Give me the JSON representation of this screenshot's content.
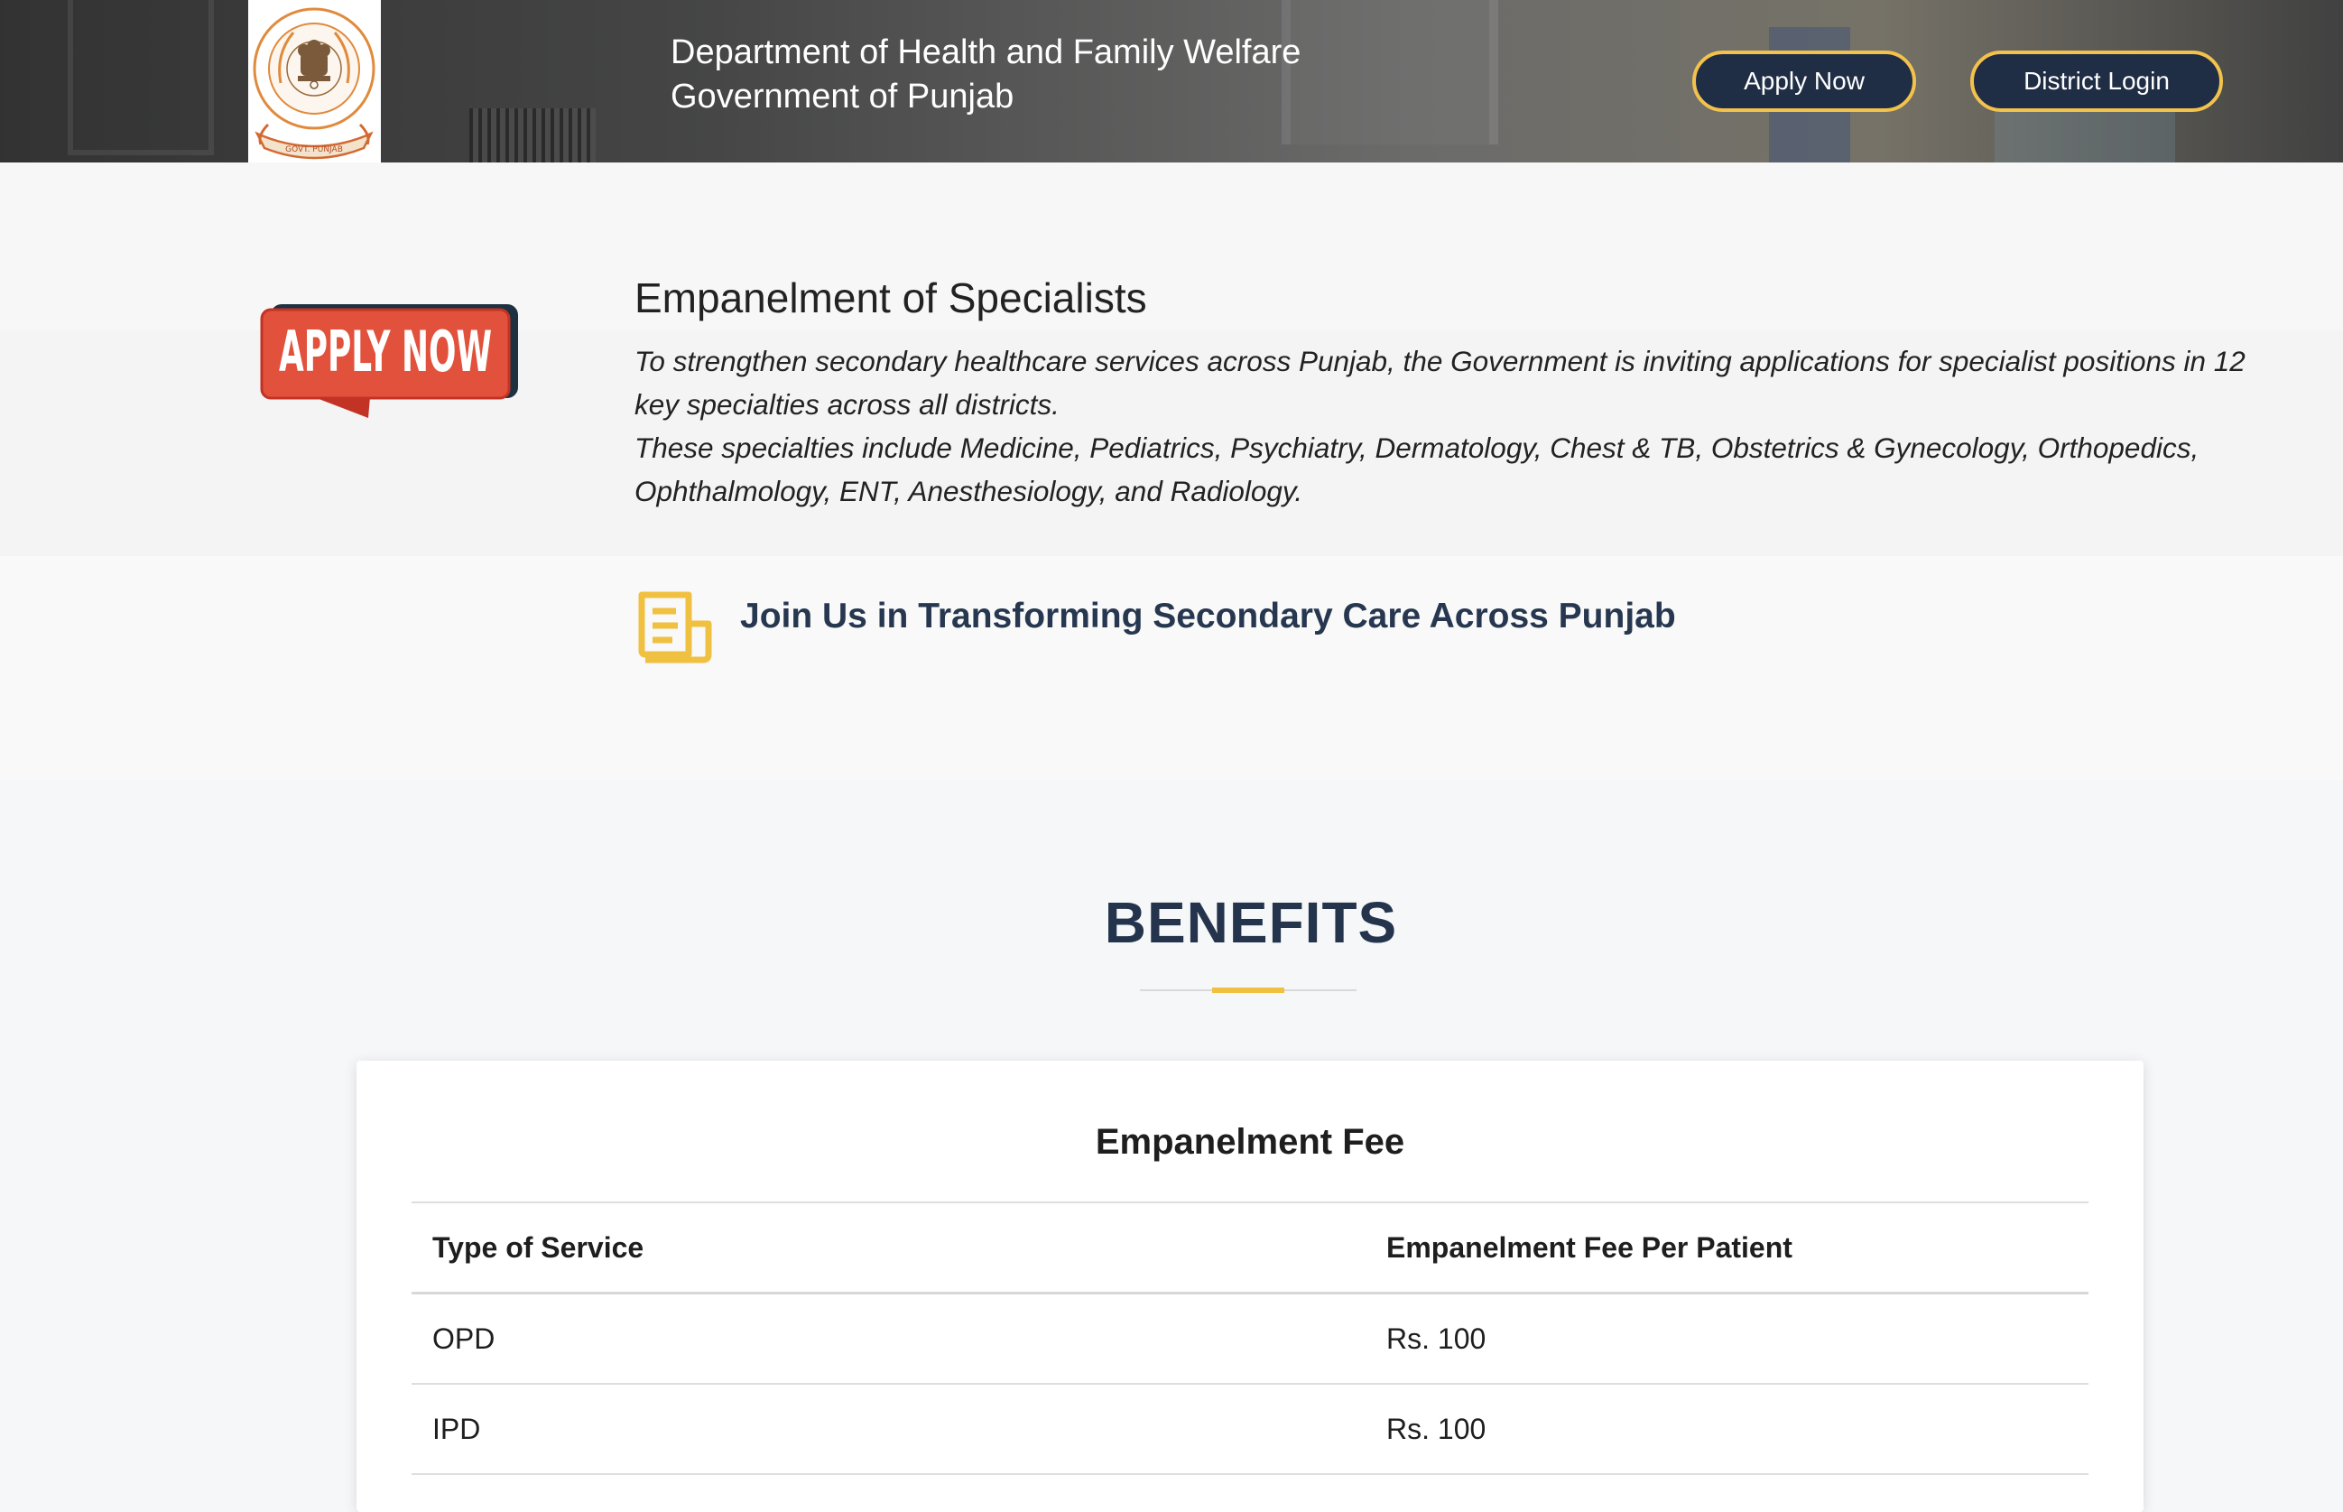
{
  "header": {
    "title_line1": "Department of Health and Family Welfare",
    "title_line2": "Government of Punjab",
    "emblem_icon": "punjab-govt-emblem",
    "emblem_caption": "GOVT. PUNJAB",
    "apply_button": "Apply Now",
    "district_login_button": "District Login",
    "button_bg": "#1f2d45",
    "button_border": "#f3c24c"
  },
  "intro": {
    "badge_text": "APPLY NOW",
    "badge_color": "#e1513c",
    "title": "Empanelment of Specialists",
    "paragraph1": "To strengthen secondary healthcare services across Punjab, the Government is inviting applications for specialist positions in 12 key specialties across all districts.",
    "paragraph2": "These specialties include Medicine, Pediatrics, Psychiatry, Dermatology, Chest & TB, Obstetrics & Gynecology, Orthopedics, Ophthalmology, ENT, Anesthesiology, and Radiology.",
    "join_icon": "document-icon",
    "join_text": "Join Us in Transforming Secondary Care Across Punjab",
    "accent_color": "#f0c040"
  },
  "benefits": {
    "title": "BENEFITS",
    "card_title": "Empanelment Fee",
    "table": {
      "headers": [
        "Type of Service",
        "Empanelment Fee Per Patient"
      ],
      "rows": [
        [
          "OPD",
          "Rs. 100"
        ],
        [
          "IPD",
          "Rs. 100"
        ]
      ]
    }
  }
}
